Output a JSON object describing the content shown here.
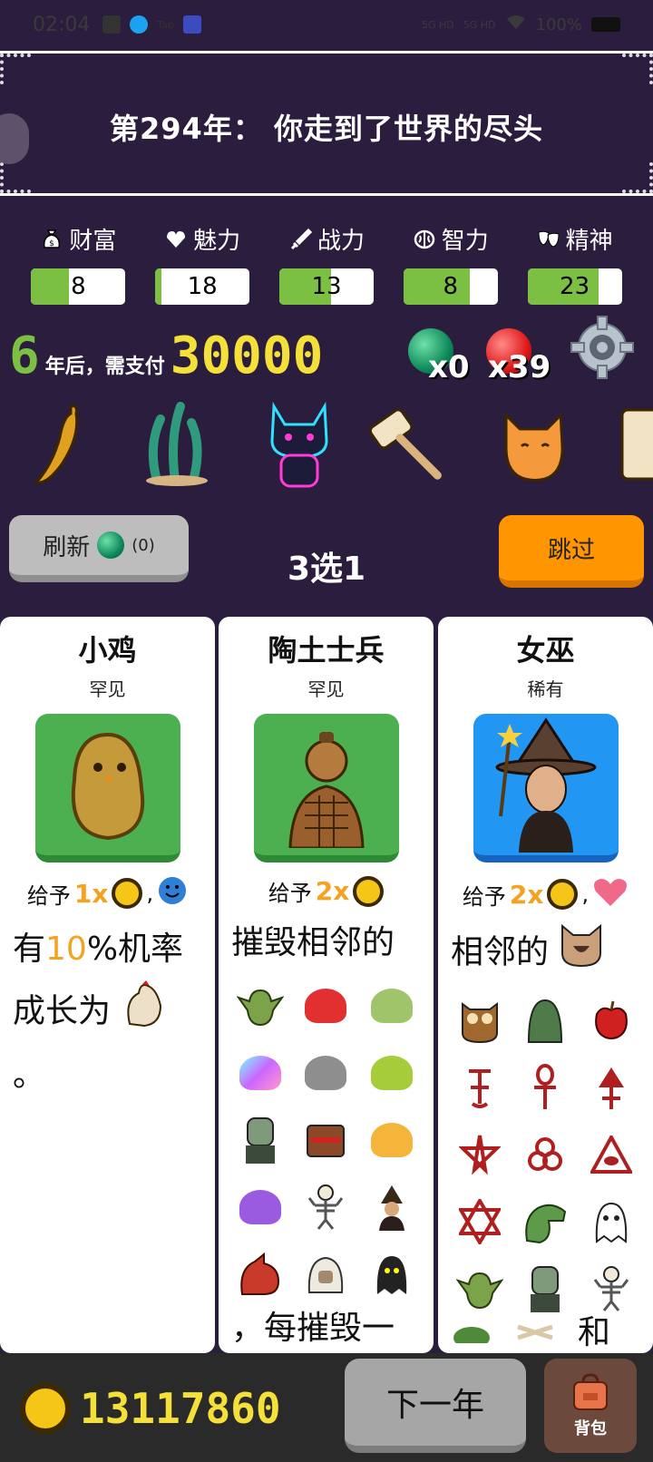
{
  "status_bar": {
    "time": "02:04",
    "signal1": "5G HD",
    "signal2": "5G HD",
    "battery": "100%",
    "app_tag": "Tap"
  },
  "banner": {
    "title": "第294年： 你走到了世界的尽头"
  },
  "stats": [
    {
      "label": "财富",
      "icon": "money-bag-icon",
      "value": "8",
      "fill": 0.4
    },
    {
      "label": "魅力",
      "icon": "heart-icon",
      "value": "18",
      "fill": 0.07
    },
    {
      "label": "战力",
      "icon": "sword-icon",
      "value": "13",
      "fill": 0.55
    },
    {
      "label": "智力",
      "icon": "brain-icon",
      "value": "8",
      "fill": 0.7
    },
    {
      "label": "精神",
      "icon": "theater-mask-icon",
      "value": "23",
      "fill": 0.75
    }
  ],
  "payment": {
    "years": "6",
    "text": "年后，需支付",
    "amount": "30000"
  },
  "orbs": {
    "green": "x0",
    "red": "x39"
  },
  "items": [
    "chili-pepper-icon",
    "seaweed-icon",
    "cyber-cat-icon",
    "wooden-mallet-icon",
    "orange-cat-icon",
    "scroll-icon"
  ],
  "controls": {
    "refresh_label": "刷新",
    "refresh_count": "(0)",
    "choose_label": "3选1",
    "skip_label": "跳过"
  },
  "cards": [
    {
      "name": "小鸡",
      "rarity": "罕见",
      "portrait_color": "#4caf50",
      "give_prefix": "给予",
      "give_mult": "1x",
      "give_suffix": ",",
      "desc_pre": "有",
      "desc_hl": "10",
      "desc_post": "%机率",
      "desc_line2": "成长为",
      "desc_line3": "。"
    },
    {
      "name": "陶土士兵",
      "rarity": "罕见",
      "portrait_color": "#4caf50",
      "give_prefix": "给予",
      "give_mult": "2x",
      "desc_line1": "摧毁相邻的",
      "desc_tail": "，每摧毁一"
    },
    {
      "name": "女巫",
      "rarity": "稀有",
      "portrait_color": "#2196f3",
      "give_prefix": "给予",
      "give_mult": "2x",
      "give_suffix": ",",
      "desc_line1": "相邻的",
      "desc_tail": "和"
    }
  ],
  "bottom": {
    "money": "13117860",
    "next_label": "下一年",
    "bag_label": "背包"
  }
}
